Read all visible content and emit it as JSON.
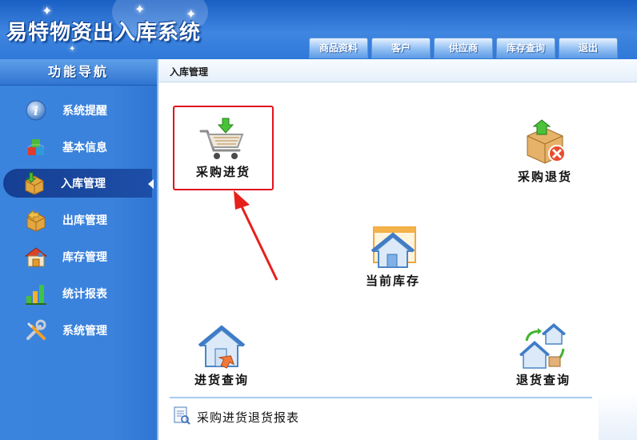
{
  "app": {
    "title": "易特物资出入库系统"
  },
  "topnav": [
    {
      "label": "商品资料"
    },
    {
      "label": "客户"
    },
    {
      "label": "供应商"
    },
    {
      "label": "库存查询"
    },
    {
      "label": "退出"
    }
  ],
  "sidebar": {
    "title": "功能导航",
    "items": [
      {
        "label": "系统提醒",
        "icon": "info-icon"
      },
      {
        "label": "基本信息",
        "icon": "cubes-icon"
      },
      {
        "label": "入库管理",
        "icon": "box-in-icon",
        "active": true
      },
      {
        "label": "出库管理",
        "icon": "box-out-icon"
      },
      {
        "label": "库存管理",
        "icon": "warehouse-icon"
      },
      {
        "label": "统计报表",
        "icon": "bar-chart-icon"
      },
      {
        "label": "系统管理",
        "icon": "tools-icon"
      }
    ]
  },
  "main": {
    "breadcrumb": "入库管理",
    "tiles": {
      "purchase": {
        "label": "采购进货"
      },
      "purchase_return": {
        "label": "采购退货"
      },
      "current_stock": {
        "label": "当前库存"
      },
      "purchase_query": {
        "label": "进货查询"
      },
      "return_query": {
        "label": "退货查询"
      }
    },
    "report_link": {
      "label": "采购进货退货报表"
    }
  },
  "colors": {
    "highlight": "#e0151b",
    "accent": "#2f78d8"
  }
}
